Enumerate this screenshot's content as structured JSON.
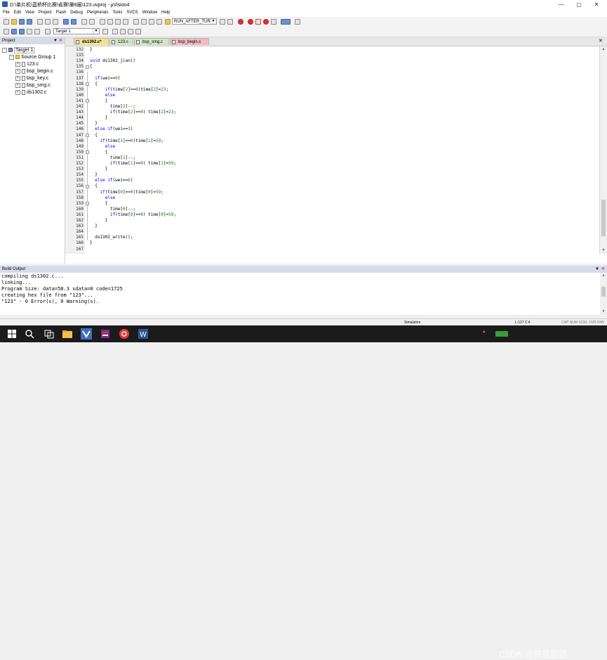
{
  "window": {
    "title": "D:\\单片机\\蓝桥杯比赛\\省赛\\第8届\\123.uvproj - µVision4",
    "controls": [
      "—",
      "▢",
      "✕"
    ]
  },
  "menu": [
    "File",
    "Edit",
    "View",
    "Project",
    "Flash",
    "Debug",
    "Peripherals",
    "Tools",
    "SVCS",
    "Window",
    "Help"
  ],
  "toolbar": {
    "debug_combo": "RUN_AFTER_TURN_",
    "target_combo": "Target 1"
  },
  "project": {
    "header": "Project",
    "target": "Target 1",
    "group": "Source Group 1",
    "files": [
      "123.c",
      "bsp_begin.c",
      "bsp_key.c",
      "bsp_smg.c",
      "ds1302.c"
    ]
  },
  "tabs": [
    {
      "label": "ds1302.c*",
      "state": "active"
    },
    {
      "label": "123.c",
      "state": "green"
    },
    {
      "label": "bsp_smg.c",
      "state": "green"
    },
    {
      "label": "bsp_begin.c",
      "state": "pink"
    }
  ],
  "editor": {
    "lines": [
      {
        "n": "132",
        "code": "}"
      },
      {
        "n": "133",
        "code": ""
      },
      {
        "n": "134",
        "code": "void ds1302_jian()"
      },
      {
        "n": "135",
        "code": "{"
      },
      {
        "n": "136",
        "code": ""
      },
      {
        "n": "137",
        "code": "  if(wei==0)"
      },
      {
        "n": "138",
        "code": "  {"
      },
      {
        "n": "139",
        "code": "      if(time[2]==0)time[2]=23;"
      },
      {
        "n": "140",
        "code": "      else"
      },
      {
        "n": "141",
        "code": "      {"
      },
      {
        "n": "142",
        "code": "        time[2]--;"
      },
      {
        "n": "143",
        "code": "        if(time[2]==0) time[2]=23;"
      },
      {
        "n": "144",
        "code": "      }"
      },
      {
        "n": "145",
        "code": "  }"
      },
      {
        "n": "146",
        "code": "  else if(wei==3)"
      },
      {
        "n": "147",
        "code": "  {"
      },
      {
        "n": "148",
        "code": "    if(time[1]==0)time[1]=59;"
      },
      {
        "n": "149",
        "code": "      else"
      },
      {
        "n": "150",
        "code": "      {"
      },
      {
        "n": "151",
        "code": "        time[1]--;"
      },
      {
        "n": "152",
        "code": "        if(time[1]==0) time[1]=59;"
      },
      {
        "n": "153",
        "code": "      }"
      },
      {
        "n": "154",
        "code": "  }"
      },
      {
        "n": "155",
        "code": "  else if(wei==6)"
      },
      {
        "n": "156",
        "code": "  {"
      },
      {
        "n": "157",
        "code": "    if(time[0]==0)time[0]=59;"
      },
      {
        "n": "158",
        "code": "      else"
      },
      {
        "n": "159",
        "code": "      {"
      },
      {
        "n": "160",
        "code": "        time[0]--;"
      },
      {
        "n": "161",
        "code": "        if(time[0]==0) time[0]=59;"
      },
      {
        "n": "162",
        "code": "      }"
      },
      {
        "n": "163",
        "code": "  }"
      },
      {
        "n": "164",
        "code": ""
      },
      {
        "n": "165",
        "code": "  ds1302_write();"
      },
      {
        "n": "166",
        "code": "}"
      },
      {
        "n": "167",
        "code": ""
      }
    ]
  },
  "build": {
    "header": "Build Output",
    "lines": [
      "compiling ds1302.c...",
      "linking...",
      "Program Size: data=58.3 xdata=0 code=1725",
      "creating hex file from \"123\"...",
      "\"123\" - 0 Error(s), 0 Warning(s)."
    ]
  },
  "status": {
    "mode": "Simulation",
    "position": "L:127 C:4",
    "indicators": "CAP NUM SCRL OVR R/W"
  },
  "watermark": "CSDN @铁匠匠匠",
  "colors": {
    "keyword": "#0000ff",
    "number": "#008000",
    "active_tab": "#f3e38a",
    "panel_header": "#d6dbe9"
  }
}
